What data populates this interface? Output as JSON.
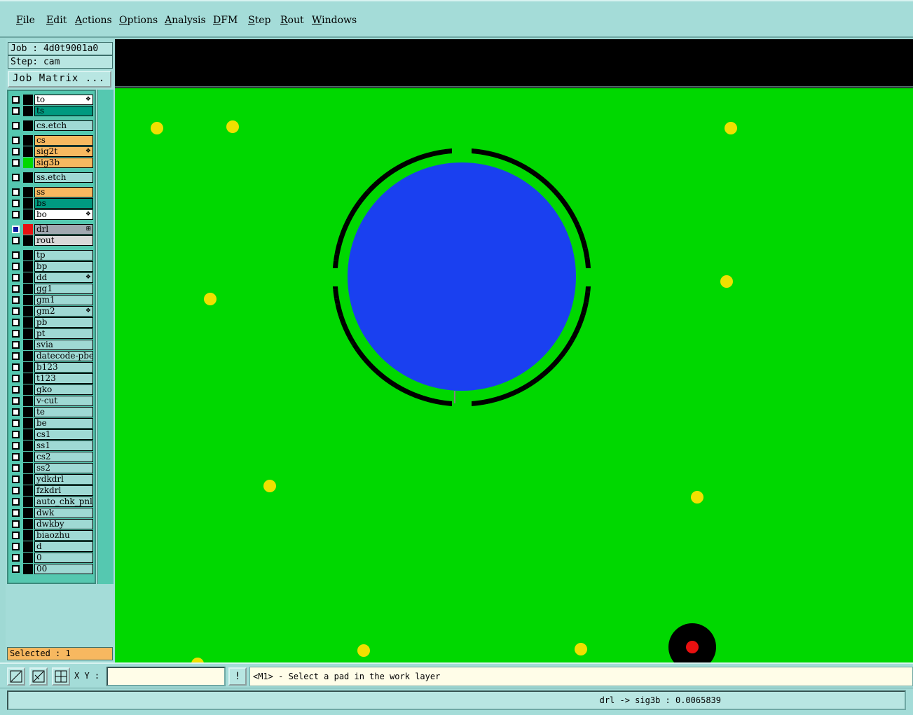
{
  "menu": [
    "File",
    "Edit",
    "Actions",
    "Options",
    "Analysis",
    "DFM",
    "Step",
    "Rout",
    "Windows"
  ],
  "job": {
    "job_label": "Job : 4d0t9001a0",
    "step_label": "Step: cam",
    "matrix_button": "Job Matrix ..."
  },
  "layers": [
    {
      "name": "to",
      "color": "#ffffff",
      "swatch": "#000000",
      "marker": "❖"
    },
    {
      "name": "ts",
      "color": "#009a80",
      "swatch": "#000000",
      "marker": ""
    },
    {
      "name": "cs.etch",
      "color": "#9fd9d4",
      "swatch": "#000000",
      "marker": ""
    },
    {
      "name": "cs",
      "color": "#f7b860",
      "swatch": "#000000",
      "marker": ""
    },
    {
      "name": "sig2t",
      "color": "#f7b860",
      "swatch": "#000000",
      "marker": "❖"
    },
    {
      "name": "sig3b",
      "color": "#f7b860",
      "swatch": "#00d800",
      "marker": ""
    },
    {
      "name": "ss.etch",
      "color": "#9fd9d4",
      "swatch": "#000000",
      "marker": ""
    },
    {
      "name": "ss",
      "color": "#f7b860",
      "swatch": "#000000",
      "marker": ""
    },
    {
      "name": "bs",
      "color": "#009a80",
      "swatch": "#000000",
      "marker": ""
    },
    {
      "name": "bo",
      "color": "#ffffff",
      "swatch": "#000000",
      "marker": "❖"
    },
    {
      "name": "drl",
      "color": "#a0a8b0",
      "swatch": "#e81010",
      "marker": "⊞"
    },
    {
      "name": "rout",
      "color": "#d8d8d8",
      "swatch": "#000000",
      "marker": ""
    },
    {
      "name": "tp",
      "color": "#9fd9d4",
      "swatch": "#000000",
      "marker": ""
    },
    {
      "name": "bp",
      "color": "#9fd9d4",
      "swatch": "#000000",
      "marker": ""
    },
    {
      "name": "dd",
      "color": "#9fd9d4",
      "swatch": "#000000",
      "marker": "❖"
    },
    {
      "name": "gg1",
      "color": "#9fd9d4",
      "swatch": "#000000",
      "marker": ""
    },
    {
      "name": "gm1",
      "color": "#9fd9d4",
      "swatch": "#000000",
      "marker": ""
    },
    {
      "name": "gm2",
      "color": "#9fd9d4",
      "swatch": "#000000",
      "marker": "❖"
    },
    {
      "name": "pb",
      "color": "#9fd9d4",
      "swatch": "#000000",
      "marker": ""
    },
    {
      "name": "pt",
      "color": "#9fd9d4",
      "swatch": "#000000",
      "marker": ""
    },
    {
      "name": "svia",
      "color": "#9fd9d4",
      "swatch": "#000000",
      "marker": ""
    },
    {
      "name": "datecode-pbe",
      "color": "#9fd9d4",
      "swatch": "#000000",
      "marker": ""
    },
    {
      "name": "b123",
      "color": "#9fd9d4",
      "swatch": "#000000",
      "marker": ""
    },
    {
      "name": "t123",
      "color": "#9fd9d4",
      "swatch": "#000000",
      "marker": ""
    },
    {
      "name": "gko",
      "color": "#9fd9d4",
      "swatch": "#000000",
      "marker": ""
    },
    {
      "name": "v-cut",
      "color": "#9fd9d4",
      "swatch": "#000000",
      "marker": ""
    },
    {
      "name": "te",
      "color": "#9fd9d4",
      "swatch": "#000000",
      "marker": ""
    },
    {
      "name": "be",
      "color": "#9fd9d4",
      "swatch": "#000000",
      "marker": ""
    },
    {
      "name": "cs1",
      "color": "#9fd9d4",
      "swatch": "#000000",
      "marker": ""
    },
    {
      "name": "ss1",
      "color": "#9fd9d4",
      "swatch": "#000000",
      "marker": ""
    },
    {
      "name": "cs2",
      "color": "#9fd9d4",
      "swatch": "#000000",
      "marker": ""
    },
    {
      "name": "ss2",
      "color": "#9fd9d4",
      "swatch": "#000000",
      "marker": ""
    },
    {
      "name": "ydkdrl",
      "color": "#9fd9d4",
      "swatch": "#000000",
      "marker": ""
    },
    {
      "name": "fzkdrl",
      "color": "#9fd9d4",
      "swatch": "#000000",
      "marker": ""
    },
    {
      "name": "auto_chk_pnl",
      "color": "#9fd9d4",
      "swatch": "#000000",
      "marker": ""
    },
    {
      "name": "dwk",
      "color": "#9fd9d4",
      "swatch": "#000000",
      "marker": ""
    },
    {
      "name": "dwkby",
      "color": "#9fd9d4",
      "swatch": "#000000",
      "marker": ""
    },
    {
      "name": "biaozhu",
      "color": "#9fd9d4",
      "swatch": "#000000",
      "marker": ""
    },
    {
      "name": "d",
      "color": "#9fd9d4",
      "swatch": "#000000",
      "marker": ""
    },
    {
      "name": "0",
      "color": "#9fd9d4",
      "swatch": "#000000",
      "marker": ""
    },
    {
      "name": "00",
      "color": "#9fd9d4",
      "swatch": "#000000",
      "marker": ""
    }
  ],
  "selected": "Selected : 1",
  "bottom": {
    "xy_label": "X Y :",
    "xy_value": "",
    "info_button": "!",
    "prompt": "<M1> - Select a pad in the work layer"
  },
  "status": "drl -> sig3b : 0.0065839",
  "colors": {
    "board": "#00d800",
    "pad": "#1a40f0",
    "drill_dot": "#f0e000",
    "ring": "#000000",
    "hole_center": "#e81010"
  }
}
